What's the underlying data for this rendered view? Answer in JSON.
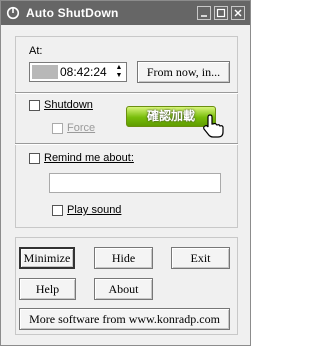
{
  "window": {
    "title": "Auto ShutDown",
    "icon": "power-app-icon"
  },
  "at_section": {
    "label": "At:",
    "time_value": "08:42:24",
    "from_now_button": "From now, in..."
  },
  "shutdown_section": {
    "shutdown_label": "Shutdown",
    "shutdown_checked": false,
    "force_label": "Force",
    "force_checked": false,
    "force_enabled": false,
    "action_button_label": "確認加載",
    "cursor_icon": "hand-pointer-icon"
  },
  "remind_section": {
    "remind_label": "Remind me about:",
    "remind_checked": false,
    "remind_text": "",
    "play_sound_label": "Play sound",
    "play_sound_checked": false
  },
  "buttons": {
    "minimize": "Minimize",
    "hide": "Hide",
    "exit": "Exit",
    "help": "Help",
    "about": "About",
    "more_software": "More software from www.konradp.com"
  },
  "colors": {
    "titlebar": "#666666",
    "green_button": "#78bd0a"
  }
}
